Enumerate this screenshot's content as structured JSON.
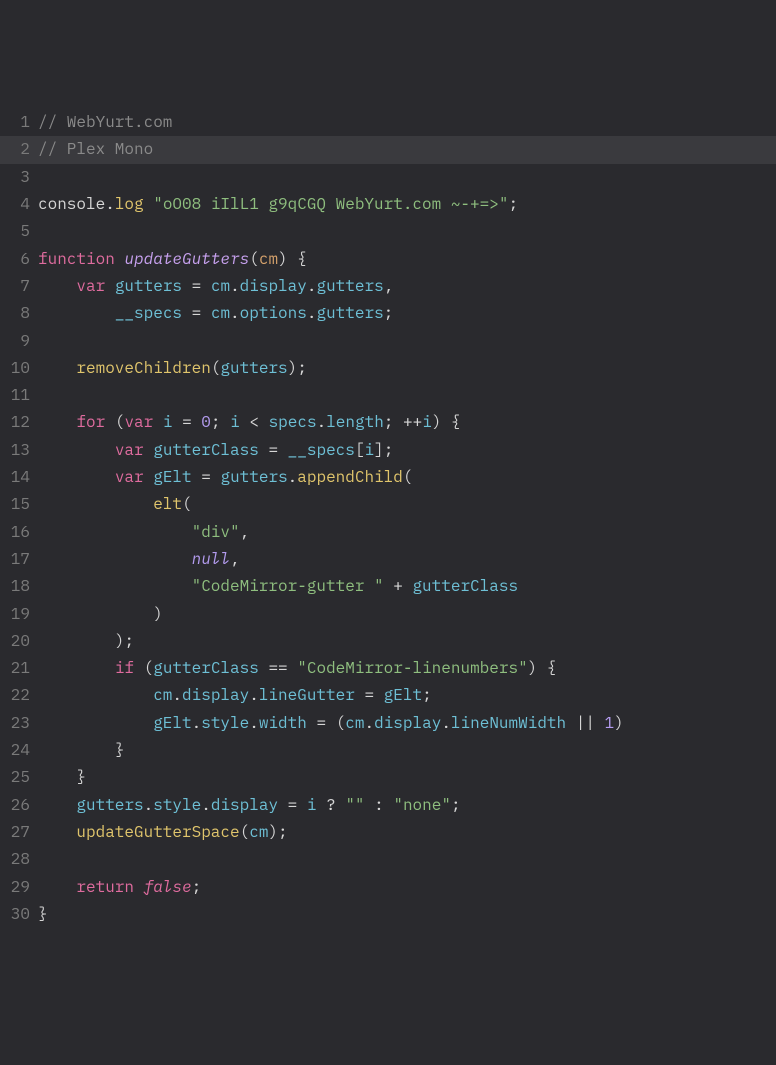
{
  "editor": {
    "font": "Plex Mono",
    "site": "WebYurt.com",
    "highlighted_line": 2,
    "lines": [
      {
        "n": 1,
        "tokens": [
          [
            "comment",
            "// WebYurt.com"
          ]
        ]
      },
      {
        "n": 2,
        "tokens": [
          [
            "comment",
            "// Plex Mono"
          ]
        ]
      },
      {
        "n": 3,
        "tokens": []
      },
      {
        "n": 4,
        "tokens": [
          [
            "ident",
            "console"
          ],
          [
            "punct",
            "."
          ],
          [
            "func",
            "log"
          ],
          [
            "ident",
            " "
          ],
          [
            "string",
            "\"oO08 iIlL1 g9qCGQ WebYurt.com ~-+=>\""
          ],
          [
            "punct",
            ";"
          ]
        ]
      },
      {
        "n": 5,
        "tokens": []
      },
      {
        "n": 6,
        "tokens": [
          [
            "keyword",
            "function"
          ],
          [
            "ident",
            " "
          ],
          [
            "def",
            "updateGutters"
          ],
          [
            "punct",
            "("
          ],
          [
            "param",
            "cm"
          ],
          [
            "punct",
            ")"
          ],
          [
            "ident",
            " "
          ],
          [
            "punct",
            "{"
          ]
        ]
      },
      {
        "n": 7,
        "tokens": [
          [
            "ident",
            "    "
          ],
          [
            "keyword",
            "var"
          ],
          [
            "ident",
            " "
          ],
          [
            "variable",
            "gutters"
          ],
          [
            "ident",
            " "
          ],
          [
            "operator",
            "="
          ],
          [
            "ident",
            " "
          ],
          [
            "variable",
            "cm"
          ],
          [
            "punct",
            "."
          ],
          [
            "property",
            "display"
          ],
          [
            "punct",
            "."
          ],
          [
            "property",
            "gutters"
          ],
          [
            "punct",
            ","
          ]
        ]
      },
      {
        "n": 8,
        "tokens": [
          [
            "ident",
            "        "
          ],
          [
            "variable",
            "__specs"
          ],
          [
            "ident",
            " "
          ],
          [
            "operator",
            "="
          ],
          [
            "ident",
            " "
          ],
          [
            "variable",
            "cm"
          ],
          [
            "punct",
            "."
          ],
          [
            "property",
            "options"
          ],
          [
            "punct",
            "."
          ],
          [
            "property",
            "gutters"
          ],
          [
            "punct",
            ";"
          ]
        ]
      },
      {
        "n": 9,
        "tokens": []
      },
      {
        "n": 10,
        "tokens": [
          [
            "ident",
            "    "
          ],
          [
            "func",
            "removeChildren"
          ],
          [
            "punct",
            "("
          ],
          [
            "variable",
            "gutters"
          ],
          [
            "punct",
            ")"
          ],
          [
            "punct",
            ";"
          ]
        ]
      },
      {
        "n": 11,
        "tokens": []
      },
      {
        "n": 12,
        "tokens": [
          [
            "ident",
            "    "
          ],
          [
            "keyword",
            "for"
          ],
          [
            "ident",
            " "
          ],
          [
            "punct",
            "("
          ],
          [
            "keyword",
            "var"
          ],
          [
            "ident",
            " "
          ],
          [
            "variable",
            "i"
          ],
          [
            "ident",
            " "
          ],
          [
            "operator",
            "="
          ],
          [
            "ident",
            " "
          ],
          [
            "number",
            "0"
          ],
          [
            "punct",
            ";"
          ],
          [
            "ident",
            " "
          ],
          [
            "variable",
            "i"
          ],
          [
            "ident",
            " "
          ],
          [
            "operator",
            "<"
          ],
          [
            "ident",
            " "
          ],
          [
            "variable",
            "specs"
          ],
          [
            "punct",
            "."
          ],
          [
            "property",
            "length"
          ],
          [
            "punct",
            ";"
          ],
          [
            "ident",
            " "
          ],
          [
            "operator",
            "++"
          ],
          [
            "variable",
            "i"
          ],
          [
            "punct",
            ")"
          ],
          [
            "ident",
            " "
          ],
          [
            "punct",
            "{"
          ]
        ]
      },
      {
        "n": 13,
        "tokens": [
          [
            "ident",
            "        "
          ],
          [
            "keyword",
            "var"
          ],
          [
            "ident",
            " "
          ],
          [
            "variable",
            "gutterClass"
          ],
          [
            "ident",
            " "
          ],
          [
            "operator",
            "="
          ],
          [
            "ident",
            " "
          ],
          [
            "variable",
            "__specs"
          ],
          [
            "punct",
            "["
          ],
          [
            "variable",
            "i"
          ],
          [
            "punct",
            "]"
          ],
          [
            "punct",
            ";"
          ]
        ]
      },
      {
        "n": 14,
        "tokens": [
          [
            "ident",
            "        "
          ],
          [
            "keyword",
            "var"
          ],
          [
            "ident",
            " "
          ],
          [
            "variable",
            "gElt"
          ],
          [
            "ident",
            " "
          ],
          [
            "operator",
            "="
          ],
          [
            "ident",
            " "
          ],
          [
            "variable",
            "gutters"
          ],
          [
            "punct",
            "."
          ],
          [
            "func",
            "appendChild"
          ],
          [
            "punct",
            "("
          ]
        ]
      },
      {
        "n": 15,
        "tokens": [
          [
            "ident",
            "            "
          ],
          [
            "func",
            "elt"
          ],
          [
            "punct",
            "("
          ]
        ]
      },
      {
        "n": 16,
        "tokens": [
          [
            "ident",
            "                "
          ],
          [
            "string",
            "\"div\""
          ],
          [
            "punct",
            ","
          ]
        ]
      },
      {
        "n": 17,
        "tokens": [
          [
            "ident",
            "                "
          ],
          [
            "atom",
            "null"
          ],
          [
            "punct",
            ","
          ]
        ]
      },
      {
        "n": 18,
        "tokens": [
          [
            "ident",
            "                "
          ],
          [
            "string",
            "\"CodeMirror-gutter \""
          ],
          [
            "ident",
            " "
          ],
          [
            "operator",
            "+"
          ],
          [
            "ident",
            " "
          ],
          [
            "variable",
            "gutterClass"
          ]
        ]
      },
      {
        "n": 19,
        "tokens": [
          [
            "ident",
            "            "
          ],
          [
            "punct",
            ")"
          ]
        ]
      },
      {
        "n": 20,
        "tokens": [
          [
            "ident",
            "        "
          ],
          [
            "punct",
            ")"
          ],
          [
            "punct",
            ";"
          ]
        ]
      },
      {
        "n": 21,
        "tokens": [
          [
            "ident",
            "        "
          ],
          [
            "keyword",
            "if"
          ],
          [
            "ident",
            " "
          ],
          [
            "punct",
            "("
          ],
          [
            "variable",
            "gutterClass"
          ],
          [
            "ident",
            " "
          ],
          [
            "operator",
            "=="
          ],
          [
            "ident",
            " "
          ],
          [
            "string",
            "\"CodeMirror-linenumbers\""
          ],
          [
            "punct",
            ")"
          ],
          [
            "ident",
            " "
          ],
          [
            "punct",
            "{"
          ]
        ]
      },
      {
        "n": 22,
        "tokens": [
          [
            "ident",
            "            "
          ],
          [
            "variable",
            "cm"
          ],
          [
            "punct",
            "."
          ],
          [
            "property",
            "display"
          ],
          [
            "punct",
            "."
          ],
          [
            "property",
            "lineGutter"
          ],
          [
            "ident",
            " "
          ],
          [
            "operator",
            "="
          ],
          [
            "ident",
            " "
          ],
          [
            "variable",
            "gElt"
          ],
          [
            "punct",
            ";"
          ]
        ]
      },
      {
        "n": 23,
        "tokens": [
          [
            "ident",
            "            "
          ],
          [
            "variable",
            "gElt"
          ],
          [
            "punct",
            "."
          ],
          [
            "property",
            "style"
          ],
          [
            "punct",
            "."
          ],
          [
            "property",
            "width"
          ],
          [
            "ident",
            " "
          ],
          [
            "operator",
            "="
          ],
          [
            "ident",
            " "
          ],
          [
            "punct",
            "("
          ],
          [
            "variable",
            "cm"
          ],
          [
            "punct",
            "."
          ],
          [
            "property",
            "display"
          ],
          [
            "punct",
            "."
          ],
          [
            "property",
            "lineNumWidth"
          ],
          [
            "ident",
            " "
          ],
          [
            "operator",
            "||"
          ],
          [
            "ident",
            " "
          ],
          [
            "number",
            "1"
          ],
          [
            "punct",
            ")"
          ],
          [
            "ident",
            " "
          ]
        ]
      },
      {
        "n": 24,
        "tokens": [
          [
            "ident",
            "        "
          ],
          [
            "punct",
            "}"
          ]
        ]
      },
      {
        "n": 25,
        "tokens": [
          [
            "ident",
            "    "
          ],
          [
            "punct",
            "}"
          ]
        ]
      },
      {
        "n": 26,
        "tokens": [
          [
            "ident",
            "    "
          ],
          [
            "variable",
            "gutters"
          ],
          [
            "punct",
            "."
          ],
          [
            "property",
            "style"
          ],
          [
            "punct",
            "."
          ],
          [
            "property",
            "display"
          ],
          [
            "ident",
            " "
          ],
          [
            "operator",
            "="
          ],
          [
            "ident",
            " "
          ],
          [
            "variable",
            "i"
          ],
          [
            "ident",
            " "
          ],
          [
            "operator",
            "?"
          ],
          [
            "ident",
            " "
          ],
          [
            "string",
            "\"\""
          ],
          [
            "ident",
            " "
          ],
          [
            "operator",
            ":"
          ],
          [
            "ident",
            " "
          ],
          [
            "string",
            "\"none\""
          ],
          [
            "punct",
            ";"
          ]
        ]
      },
      {
        "n": 27,
        "tokens": [
          [
            "ident",
            "    "
          ],
          [
            "func",
            "updateGutterSpace"
          ],
          [
            "punct",
            "("
          ],
          [
            "variable",
            "cm"
          ],
          [
            "punct",
            ")"
          ],
          [
            "punct",
            ";"
          ]
        ]
      },
      {
        "n": 28,
        "tokens": []
      },
      {
        "n": 29,
        "tokens": [
          [
            "ident",
            "    "
          ],
          [
            "keyword",
            "return"
          ],
          [
            "ident",
            " "
          ],
          [
            "keyword2",
            "false"
          ],
          [
            "punct",
            ";"
          ]
        ]
      },
      {
        "n": 30,
        "tokens": [
          [
            "punct",
            "}"
          ]
        ]
      }
    ]
  }
}
